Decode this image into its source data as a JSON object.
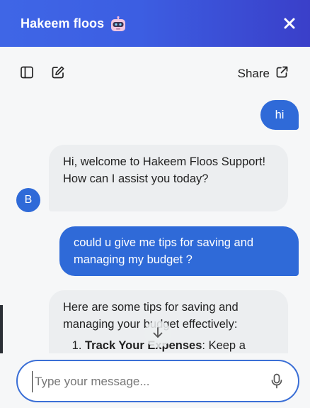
{
  "header": {
    "title": "Hakeem floos",
    "mascot_icon": "robot-icon",
    "close_icon": "close-icon",
    "gradient_start": "#3f66e6",
    "gradient_end": "#3a3fc9"
  },
  "toolbar": {
    "sidebar_icon": "sidebar-toggle-icon",
    "new_chat_icon": "edit-icon",
    "share_label": "Share",
    "share_icon": "external-link-icon"
  },
  "messages": [
    {
      "role": "user",
      "text": "hi"
    },
    {
      "role": "bot",
      "text": "Hi, welcome to Hakeem Floos Support! How can I assist you today?"
    },
    {
      "role": "user",
      "text": "could u give me tips for saving and managing my budget ?"
    },
    {
      "role": "bot",
      "intro": "Here are some tips for saving and managing your budget effectively:",
      "list_item_title": "Track Your Expenses",
      "list_item_rest": ": Keep a"
    }
  ],
  "avatar": {
    "letter": "B"
  },
  "composer": {
    "placeholder": "Type your message...",
    "value": "",
    "mic_icon": "microphone-icon",
    "scroll_icon": "arrow-down-icon"
  },
  "colors": {
    "accent": "#2f6ad8",
    "bot_bubble": "#eceef0",
    "background": "#f6f7f8"
  }
}
